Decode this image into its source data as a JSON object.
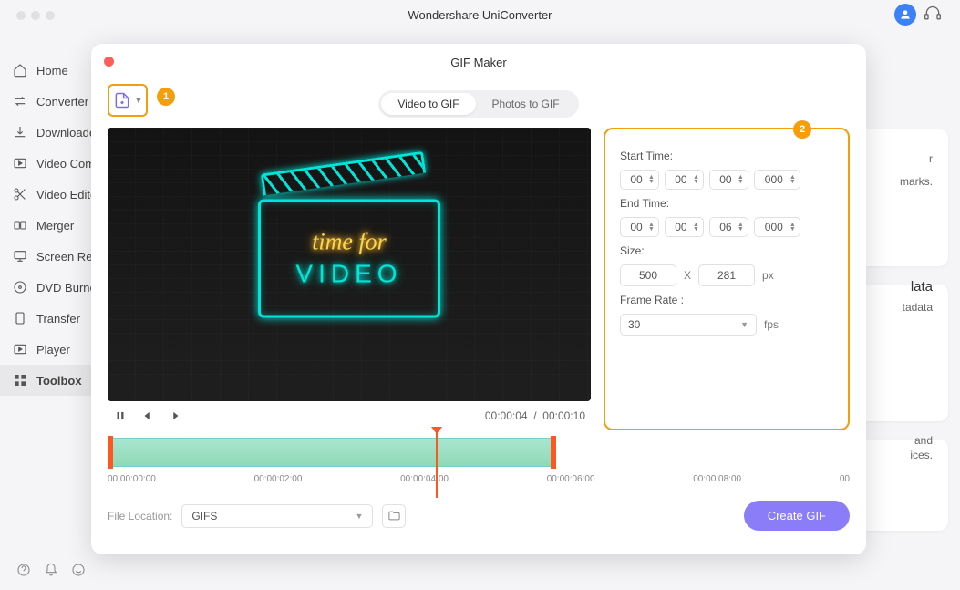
{
  "app": {
    "title": "Wondershare UniConverter"
  },
  "sidebar": {
    "items": [
      {
        "label": "Home"
      },
      {
        "label": "Converter"
      },
      {
        "label": "Downloader"
      },
      {
        "label": "Video Compressor"
      },
      {
        "label": "Video Editor"
      },
      {
        "label": "Merger"
      },
      {
        "label": "Screen Recorder"
      },
      {
        "label": "DVD Burner"
      },
      {
        "label": "Transfer"
      },
      {
        "label": "Player"
      },
      {
        "label": "Toolbox"
      }
    ]
  },
  "background": {
    "text1": "r",
    "text2": "marks.",
    "text3": "lata",
    "text4": "tadata",
    "text5": "and",
    "text6": "ices."
  },
  "modal": {
    "title": "GIF Maker",
    "tabs": {
      "video": "Video to GIF",
      "photos": "Photos to GIF"
    },
    "callout1": "1",
    "callout2": "2",
    "preview": {
      "neon_line1": "time for",
      "neon_line2": "VIDEO"
    },
    "playback": {
      "current": "00:00:04",
      "sep": "/",
      "total": "00:00:10"
    },
    "settings": {
      "start_label": "Start Time:",
      "start": {
        "h": "00",
        "m": "00",
        "s": "00",
        "ms": "000"
      },
      "end_label": "End Time:",
      "end": {
        "h": "00",
        "m": "00",
        "s": "06",
        "ms": "000"
      },
      "size_label": "Size:",
      "size": {
        "w": "500",
        "x": "X",
        "h": "281",
        "unit": "px"
      },
      "rate_label": "Frame Rate :",
      "rate": {
        "value": "30",
        "unit": "fps"
      }
    },
    "timeline": {
      "ticks": [
        "00:00:00:00",
        "00:00:02:00",
        "00:00:04:00",
        "00:00:06:00",
        "00:00:08:00",
        "00"
      ]
    },
    "file": {
      "label": "File Location:",
      "value": "GIFS"
    },
    "create": "Create GIF"
  }
}
